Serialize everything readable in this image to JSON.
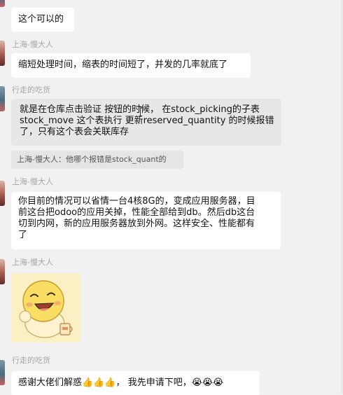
{
  "messages": {
    "m1_text": "这个可以的",
    "sender1": "上海-慢大人",
    "m2_text": "缩短处理时间，缩表的时间短了，并发的几率就底了",
    "sender2": "行走的吃货",
    "m3_line1": "就是在仓库点击验证 按钮的时候， 在stock_picking的子表",
    "m3_line2": "stock_move 这个表执行 更新reserved_quantity 的时候报错",
    "m3_line3": "了，只有这个表会关联库存",
    "quote": "上海-慢大人：他哪个报错是stock_quant的",
    "sender3": "上海-慢大人",
    "m4_line1": "你目前的情况可以省情一台4核8G的，变成应用服务器，目",
    "m4_line2": "前这台把odoo的应用关掉，性能全部给到db。然后db这台",
    "m4_line3": "切到内网，新的应用服务器放到外网。这样安全、性能都有",
    "m4_line4": "了",
    "sender4": "上海-慢大人",
    "sender5": "行走的吃货",
    "m6_text": "感谢大佬们解惑👍👍👍， 我先申请下吧，😭😭😭"
  },
  "icons": {
    "sticker": "laughing-cartoon-sticker-icon",
    "cursor": "text-cursor-icon"
  }
}
